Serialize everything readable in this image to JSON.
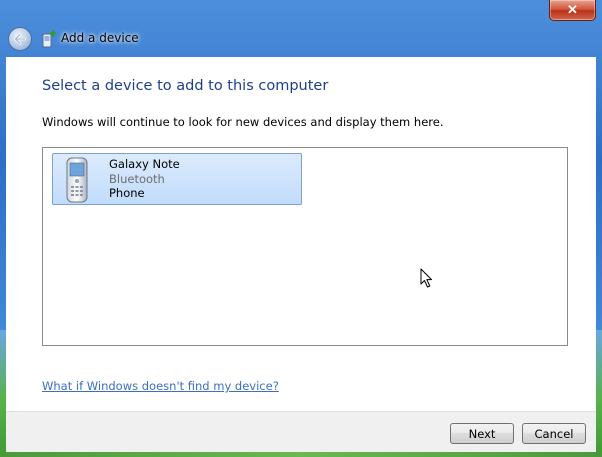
{
  "window": {
    "title": "Add a device",
    "close_glyph": "✕"
  },
  "content": {
    "heading": "Select a device to add to this computer",
    "instruction": "Windows will continue to look for new devices and display them here."
  },
  "devices": [
    {
      "name": "Galaxy Note",
      "connection": "Bluetooth",
      "category": "Phone",
      "icon": "phone-icon",
      "selected": true
    }
  ],
  "links": {
    "help": "What if Windows doesn't find my device?"
  },
  "buttons": {
    "next": "Next",
    "cancel": "Cancel"
  },
  "colors": {
    "heading": "#1e3f8a",
    "link": "#3c6ec1",
    "selection": "#c1dcfc",
    "close_button": "#c8452b"
  }
}
